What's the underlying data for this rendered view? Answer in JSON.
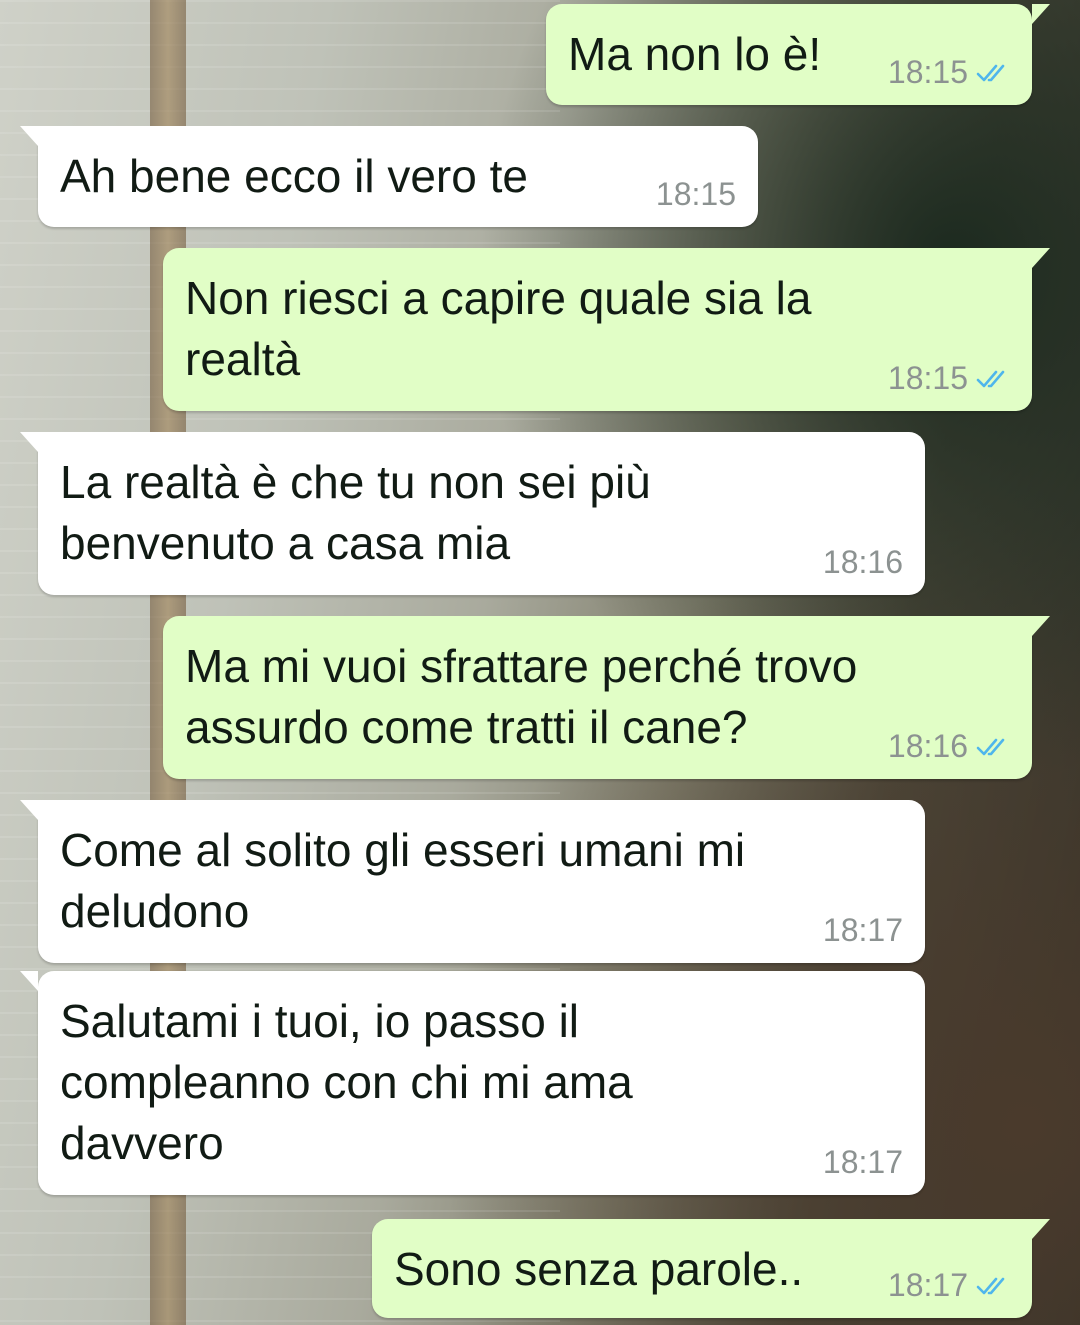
{
  "theme": {
    "incoming_bubble": "#ffffff",
    "outgoing_bubble": "#e1fec6",
    "timestamp_color": "#8c9291",
    "read_receipt_color": "#4fb6ec"
  },
  "messages": [
    {
      "direction": "outgoing",
      "text": "Ma non lo è!",
      "time": "18:15",
      "status_icon": "double-check-read-icon"
    },
    {
      "direction": "incoming",
      "text": "Ah bene ecco il vero te",
      "time": "18:15"
    },
    {
      "direction": "outgoing",
      "text": "Non riesci a capire quale sia la\nrealtà",
      "time": "18:15",
      "status_icon": "double-check-read-icon"
    },
    {
      "direction": "incoming",
      "text": "La realtà è che tu non sei più\nbenvenuto a casa mia",
      "time": "18:16"
    },
    {
      "direction": "outgoing",
      "text": "Ma mi vuoi sfrattare perché trovo\nassurdo come tratti il cane?",
      "time": "18:16",
      "status_icon": "double-check-read-icon"
    },
    {
      "direction": "incoming",
      "text": "Come al solito gli esseri umani mi\ndeludono",
      "time": "18:17"
    },
    {
      "direction": "incoming",
      "text": "Salutami i tuoi, io passo il\ncompleanno con chi mi ama\ndavvero",
      "time": "18:17"
    },
    {
      "direction": "outgoing",
      "text": "Sono senza parole..",
      "time": "18:17",
      "status_icon": "double-check-read-icon"
    }
  ]
}
